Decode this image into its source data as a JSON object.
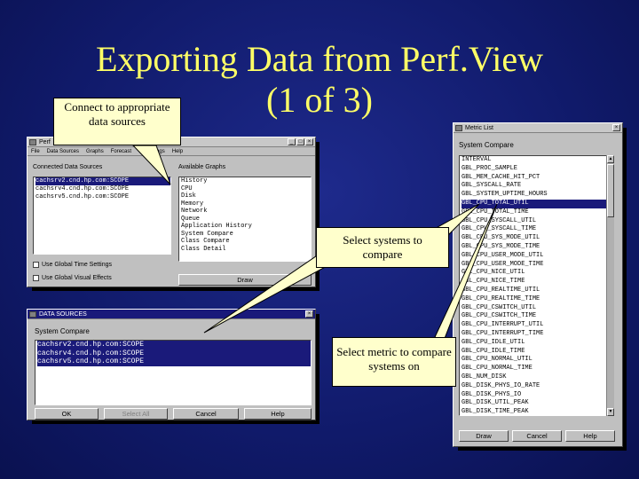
{
  "slide": {
    "title_line1": "Exporting Data from Perf.View",
    "title_line2": "(1 of 3)"
  },
  "callouts": {
    "connect": "Connect to appropriate data sources",
    "select_systems": "Select systems to compare",
    "select_metric": "Select metric to compare systems on"
  },
  "perfview_window": {
    "title": "Perf",
    "menu": [
      "File",
      "Data Sources",
      "Graphs",
      "Forecast",
      "",
      "Settings",
      "Help"
    ],
    "connected_label": "Connected Data Sources",
    "connected_sources": [
      "cachsrv2.cnd.hp.com:SCOPE",
      "cachsrv4.cnd.hp.com:SCOPE",
      "cachsrv5.cnd.hp.com:SCOPE"
    ],
    "available_label": "Available Graphs",
    "graphs": [
      "History",
      "CPU",
      "Disk",
      "Memory",
      "Network",
      "Queue",
      "Application History",
      "System Compare",
      "Class Compare",
      "Class Detail"
    ],
    "use_global_time": "Use Global Time Settings",
    "use_global_visual": "Use Global Visual Effects",
    "draw_label": "Draw"
  },
  "datasources_window": {
    "title": "DATA SOURCES",
    "label": "System Compare",
    "sources": [
      "cachsrv2.cnd.hp.com:SCOPE",
      "cachsrv4.cnd.hp.com:SCOPE",
      "cachsrv5.cnd.hp.com:SCOPE"
    ],
    "buttons": {
      "ok": "OK",
      "select_all": "Select All",
      "cancel": "Cancel",
      "help": "Help"
    }
  },
  "metric_window": {
    "title": "Metric List",
    "label": "System Compare",
    "metrics": [
      "INTERVAL",
      "GBL_PROC_SAMPLE",
      "GBL_MEM_CACHE_HIT_PCT",
      "GBL_SYSCALL_RATE",
      "GBL_SYSTEM_UPTIME_HOURS",
      "GBL_CPU_TOTAL_UTIL",
      "GBL_CPU_TOTAL_TIME",
      "GBL_CPU_SYSCALL_UTIL",
      "GBL_CPU_SYSCALL_TIME",
      "GBL_CPU_SYS_MODE_UTIL",
      "GBL_CPU_SYS_MODE_TIME",
      "GBL_CPU_USER_MODE_UTIL",
      "GBL_CPU_USER_MODE_TIME",
      "GBL_CPU_NICE_UTIL",
      "GBL_CPU_NICE_TIME",
      "GBL_CPU_REALTIME_UTIL",
      "GBL_CPU_REALTIME_TIME",
      "GBL_CPU_CSWITCH_UTIL",
      "GBL_CPU_CSWITCH_TIME",
      "GBL_CPU_INTERRUPT_UTIL",
      "GBL_CPU_INTERRUPT_TIME",
      "GBL_CPU_IDLE_UTIL",
      "GBL_CPU_IDLE_TIME",
      "GBL_CPU_NORMAL_UTIL",
      "GBL_CPU_NORMAL_TIME",
      "GBL_NUM_DISK",
      "GBL_DISK_PHYS_IO_RATE",
      "GBL_DISK_PHYS_IO",
      "GBL_DISK_UTIL_PEAK",
      "GBL_DISK_TIME_PEAK"
    ],
    "selected_index": 5,
    "buttons": {
      "draw": "Draw",
      "cancel": "Cancel",
      "help": "Help"
    }
  },
  "colors": {
    "background": "#101a6a",
    "title": "#ffff66",
    "callout": "#ffffcc",
    "selection": "#1a1a7a"
  }
}
